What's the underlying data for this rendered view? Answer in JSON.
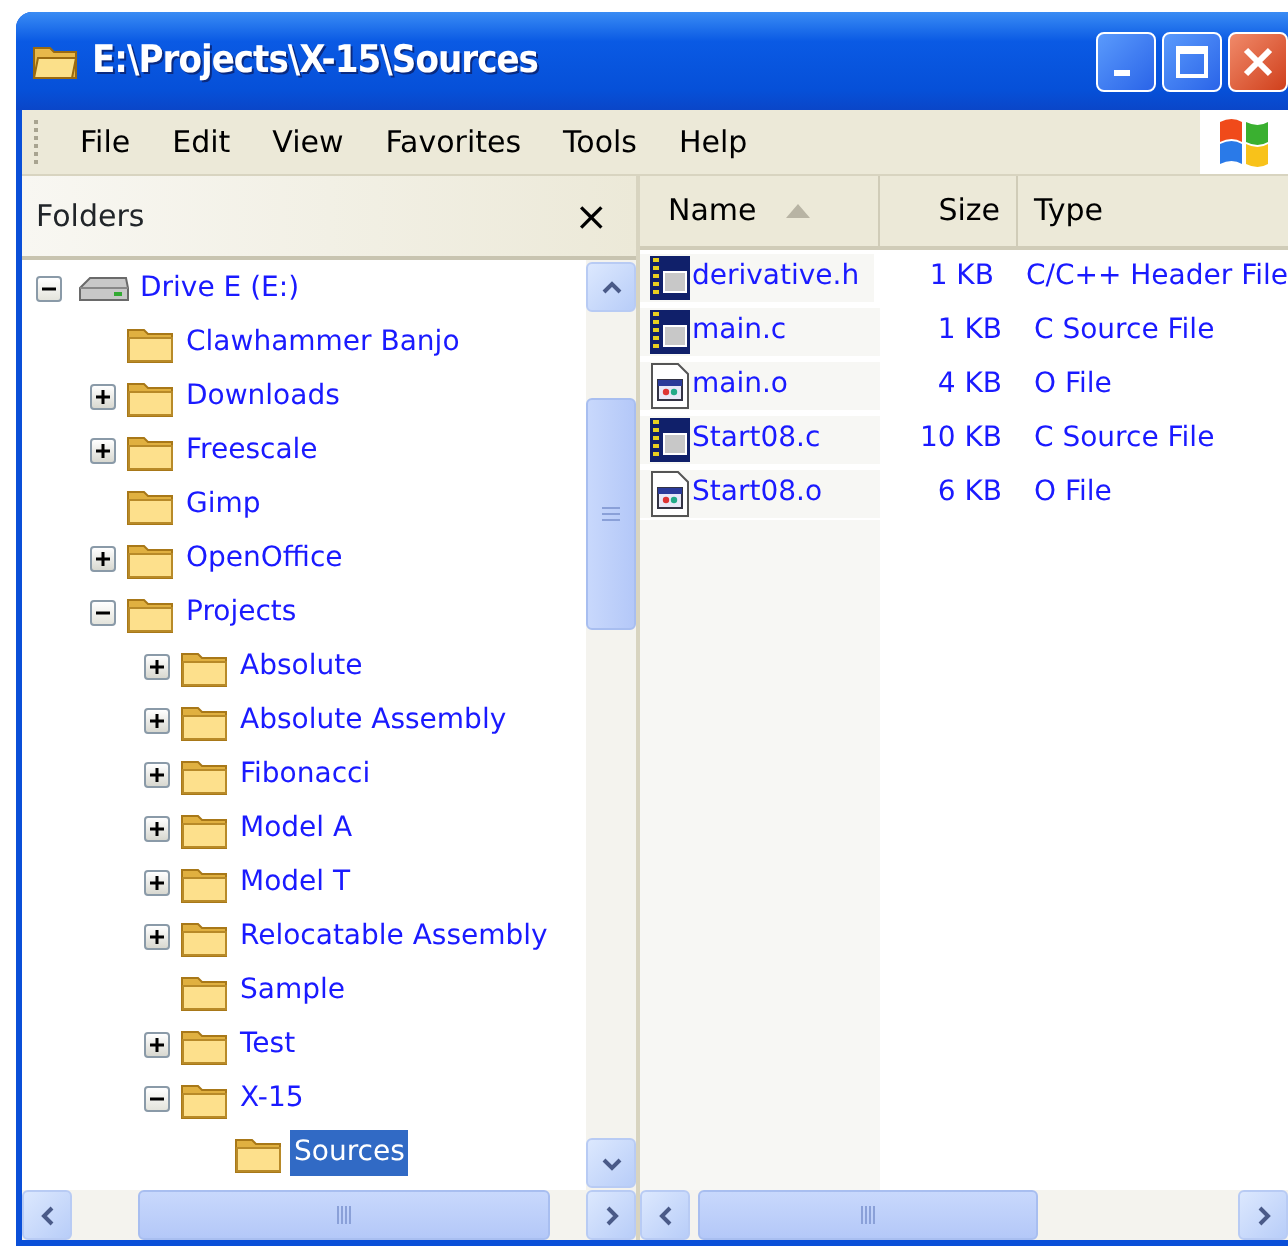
{
  "window": {
    "title": "E:\\Projects\\X-15\\Sources"
  },
  "menu": [
    "File",
    "Edit",
    "View",
    "Favorites",
    "Tools",
    "Help"
  ],
  "folders_pane": {
    "title": "Folders",
    "close": "×",
    "tree": [
      {
        "label": "Drive E (E:)",
        "kind": "drive",
        "expandable": true,
        "expanded": true,
        "selected": false,
        "children": [
          {
            "label": "Clawhammer Banjo",
            "kind": "folder",
            "expandable": false,
            "selected": false
          },
          {
            "label": "Downloads",
            "kind": "folder",
            "expandable": true,
            "expanded": false,
            "selected": false
          },
          {
            "label": "Freescale",
            "kind": "folder",
            "expandable": true,
            "expanded": false,
            "selected": false
          },
          {
            "label": "Gimp",
            "kind": "folder",
            "expandable": false,
            "selected": false
          },
          {
            "label": "OpenOffice",
            "kind": "folder",
            "expandable": true,
            "expanded": false,
            "selected": false
          },
          {
            "label": "Projects",
            "kind": "folder",
            "expandable": true,
            "expanded": true,
            "selected": false,
            "children": [
              {
                "label": "Absolute",
                "kind": "folder",
                "expandable": true,
                "expanded": false,
                "selected": false
              },
              {
                "label": "Absolute Assembly",
                "kind": "folder",
                "expandable": true,
                "expanded": false,
                "selected": false
              },
              {
                "label": "Fibonacci",
                "kind": "folder",
                "expandable": true,
                "expanded": false,
                "selected": false
              },
              {
                "label": "Model A",
                "kind": "folder",
                "expandable": true,
                "expanded": false,
                "selected": false
              },
              {
                "label": "Model T",
                "kind": "folder",
                "expandable": true,
                "expanded": false,
                "selected": false
              },
              {
                "label": "Relocatable Assembly",
                "kind": "folder",
                "expandable": true,
                "expanded": false,
                "selected": false
              },
              {
                "label": "Sample",
                "kind": "folder",
                "expandable": false,
                "selected": false
              },
              {
                "label": "Test",
                "kind": "folder",
                "expandable": true,
                "expanded": false,
                "selected": false
              },
              {
                "label": "X-15",
                "kind": "folder",
                "expandable": true,
                "expanded": true,
                "selected": false,
                "children": [
                  {
                    "label": "Sources",
                    "kind": "folder",
                    "expandable": false,
                    "selected": true
                  }
                ]
              }
            ]
          }
        ]
      }
    ]
  },
  "file_list": {
    "columns": [
      {
        "label": "Name",
        "sorted": true
      },
      {
        "label": "Size",
        "sorted": false
      },
      {
        "label": "Type",
        "sorted": false
      }
    ],
    "rows": [
      {
        "name": "derivative.h",
        "size": "1 KB",
        "type": "C/C++ Header File",
        "kind": "source"
      },
      {
        "name": "main.c",
        "size": "1 KB",
        "type": "C Source File",
        "kind": "source"
      },
      {
        "name": "main.o",
        "size": "4 KB",
        "type": "O File",
        "kind": "object"
      },
      {
        "name": "Start08.c",
        "size": "10 KB",
        "type": "C Source File",
        "kind": "source"
      },
      {
        "name": "Start08.o",
        "size": "6 KB",
        "type": "O File",
        "kind": "object"
      }
    ]
  }
}
